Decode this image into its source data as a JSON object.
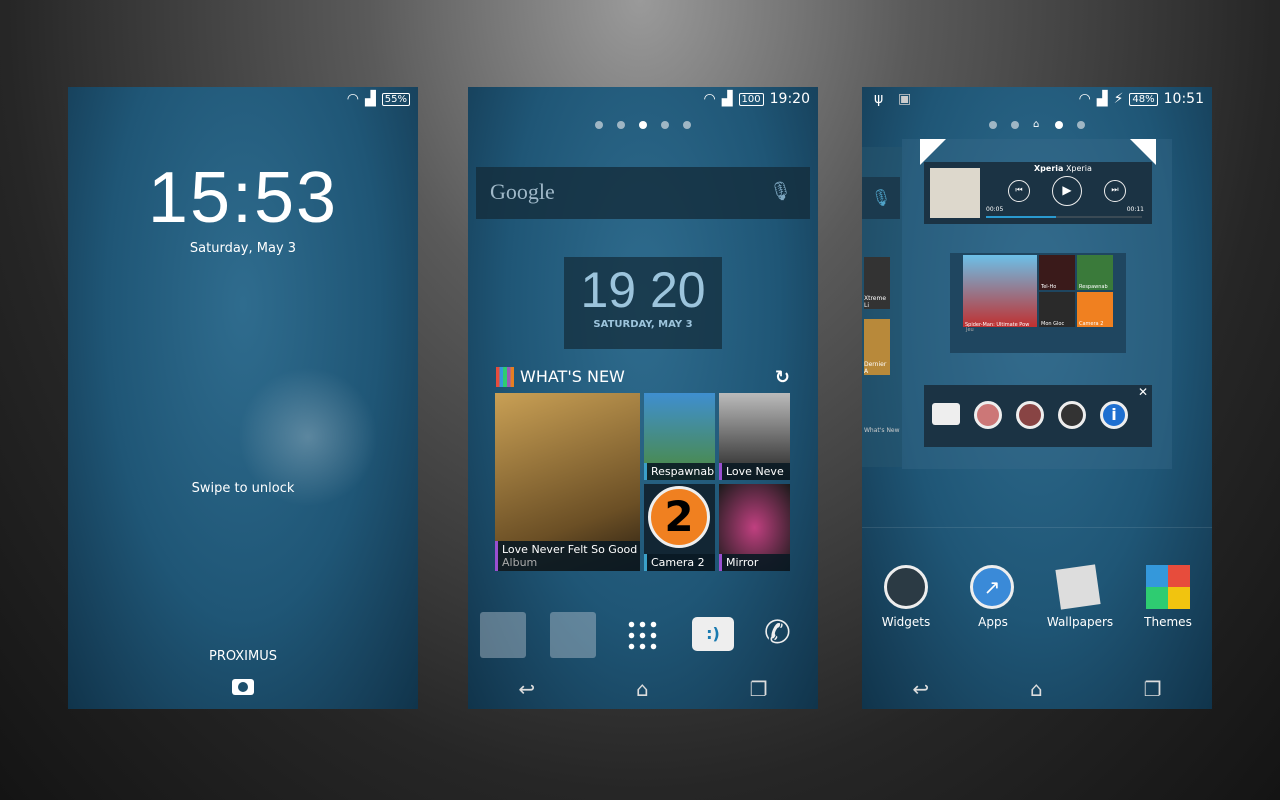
{
  "lock": {
    "status": {
      "battery": "55%"
    },
    "time": "15:53",
    "date": "Saturday, May 3",
    "swipe": "Swipe to unlock",
    "carrier": "PROXIMUS",
    "camera_icon": "camera-icon"
  },
  "home": {
    "status": {
      "battery": "100",
      "time": "19:20"
    },
    "search": {
      "brand": "Google"
    },
    "clock": {
      "time": "19 20",
      "date": "SATURDAY, MAY 3"
    },
    "whats_new": {
      "title": "WHAT'S NEW",
      "items": [
        {
          "title": "Love Never Felt So Good",
          "sub": "Album"
        },
        {
          "title": "Respawnab"
        },
        {
          "title": "Love Neve"
        },
        {
          "title": "Camera 2"
        },
        {
          "title": "Mirror"
        }
      ]
    },
    "dock": [
      "google-folder",
      "apps-folder",
      "app-drawer",
      "messaging",
      "phone"
    ]
  },
  "edit": {
    "status": {
      "battery": "48%",
      "time": "10:51"
    },
    "music": {
      "artist": "Xperia",
      "album": "Xperia",
      "elapsed": "00:05",
      "total": "00:11",
      "progress": 0.45
    },
    "apps_widget": [
      "Spider-Man: Ultimate Pow",
      "Jeu",
      "Tel-Ho",
      "Respawnab",
      "Mon Gloc",
      "Camera 2"
    ],
    "left_panel": [
      "Xtreme Li",
      "Dernier A",
      "What's New"
    ],
    "options": [
      "Widgets",
      "Apps",
      "Wallpapers",
      "Themes"
    ]
  }
}
